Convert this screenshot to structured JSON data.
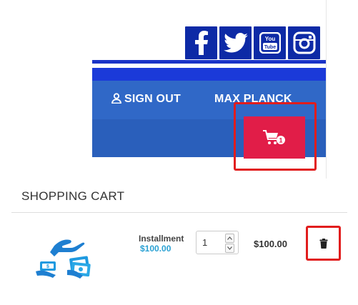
{
  "header": {
    "social_icons": [
      "facebook-icon",
      "twitter-icon",
      "youtube-icon",
      "instagram-icon"
    ],
    "youtube_text": {
      "top": "You",
      "bottom": "Tube"
    },
    "nav": {
      "sign_out_label": "SIGN OUT",
      "user_label": "MAX PLANCK"
    },
    "cart": {
      "count": "1"
    }
  },
  "cart": {
    "title": "SHOPPING CART",
    "items": [
      {
        "name": "Installment",
        "price": "$100.00",
        "quantity": "1",
        "line_total": "$100.00"
      }
    ]
  },
  "colors": {
    "social_bg": "#0d2aa6",
    "nav_bg": "#3068c7",
    "cart_button": "#e11d48",
    "price_accent": "#2aa1d3",
    "highlight": "#e11d1d"
  }
}
